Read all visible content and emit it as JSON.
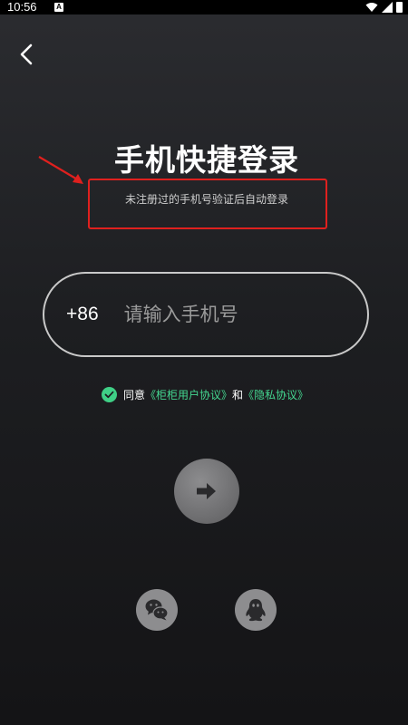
{
  "status_bar": {
    "time": "10:56",
    "notification_glyph": "A"
  },
  "header": {
    "back_icon": "chevron-left-icon"
  },
  "login": {
    "title": "手机快捷登录",
    "subtitle": "未注册过的手机号验证后自动登录"
  },
  "phone": {
    "country_code": "+86",
    "placeholder": "请输入手机号",
    "value": ""
  },
  "agreement": {
    "checked": true,
    "prefix": "同意",
    "user_agreement": "《柜柜用户协议》",
    "conjunction": "和",
    "privacy_policy": "《隐私协议》"
  },
  "social": {
    "wechat_icon": "wechat-icon",
    "qq_icon": "qq-icon"
  },
  "colors": {
    "accent_green": "#44d690",
    "annotation_red": "#e0201e",
    "background_top": "#2b2c30",
    "background_bottom": "#141416"
  }
}
